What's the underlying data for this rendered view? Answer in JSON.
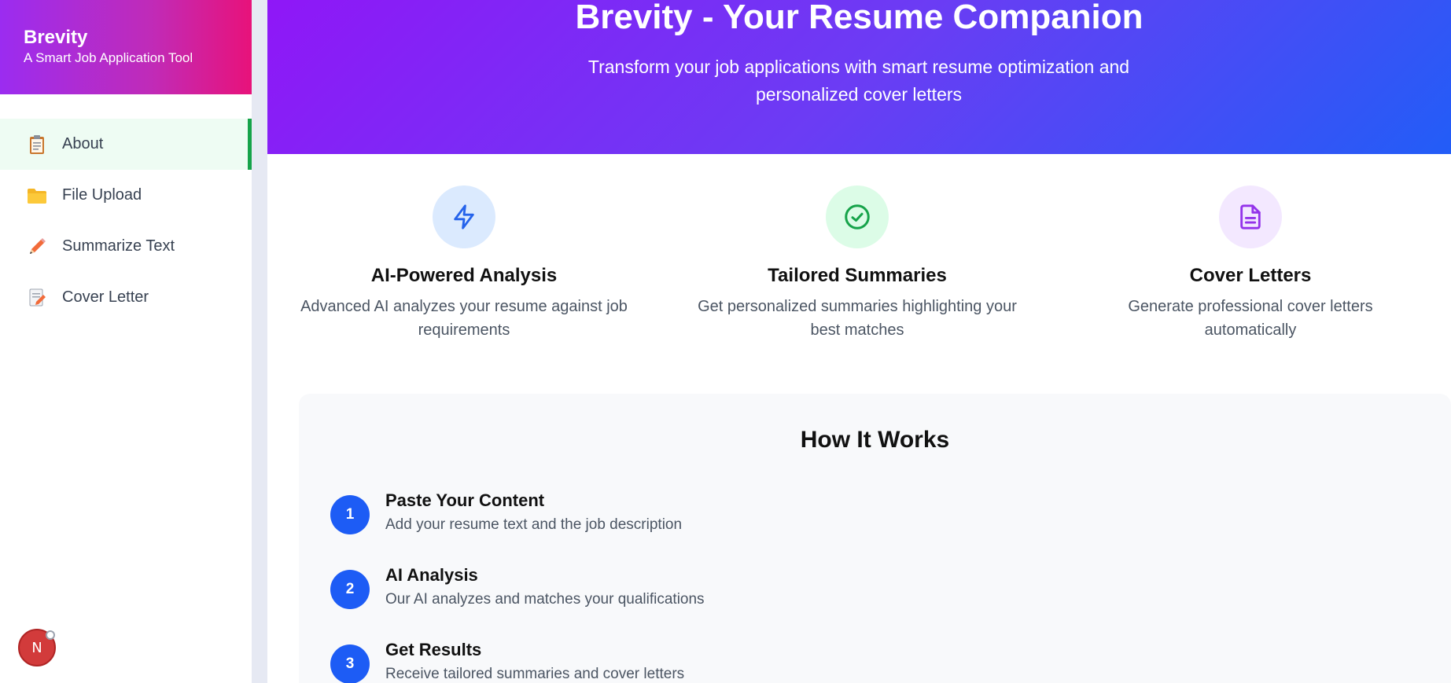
{
  "brand": {
    "title": "Brevity",
    "subtitle": "A Smart Job Application Tool"
  },
  "sidebar": {
    "items": [
      {
        "label": "About",
        "icon": "clipboard-icon",
        "active": true
      },
      {
        "label": "File Upload",
        "icon": "folder-icon",
        "active": false
      },
      {
        "label": "Summarize Text",
        "icon": "pencil-icon",
        "active": false
      },
      {
        "label": "Cover Letter",
        "icon": "document-edit-icon",
        "active": false
      }
    ]
  },
  "avatar": {
    "initial": "N"
  },
  "hero": {
    "title": "Brevity - Your Resume Companion",
    "subtitle": "Transform your job applications with smart resume optimization and personalized cover letters"
  },
  "features": [
    {
      "title": "AI-Powered Analysis",
      "desc": "Advanced AI analyzes your resume against job requirements",
      "icon": "lightning-icon",
      "color": "#2563eb",
      "bg": "#dbeafe"
    },
    {
      "title": "Tailored Summaries",
      "desc": "Get personalized summaries highlighting your best matches",
      "icon": "check-circle-icon",
      "color": "#16a34a",
      "bg": "#dcfce7"
    },
    {
      "title": "Cover Letters",
      "desc": "Generate professional cover letters automatically",
      "icon": "file-text-icon",
      "color": "#9333ea",
      "bg": "#f3e8ff"
    }
  ],
  "how": {
    "title": "How It Works",
    "steps": [
      {
        "num": "1",
        "title": "Paste Your Content",
        "desc": "Add your resume text and the job description"
      },
      {
        "num": "2",
        "title": "AI Analysis",
        "desc": "Our AI analyzes and matches your qualifications"
      },
      {
        "num": "3",
        "title": "Get Results",
        "desc": "Receive tailored summaries and cover letters"
      }
    ]
  },
  "colors": {
    "accent": "#1d5cf5",
    "active_bar": "#16a34a",
    "active_bg": "#eefcf3"
  }
}
